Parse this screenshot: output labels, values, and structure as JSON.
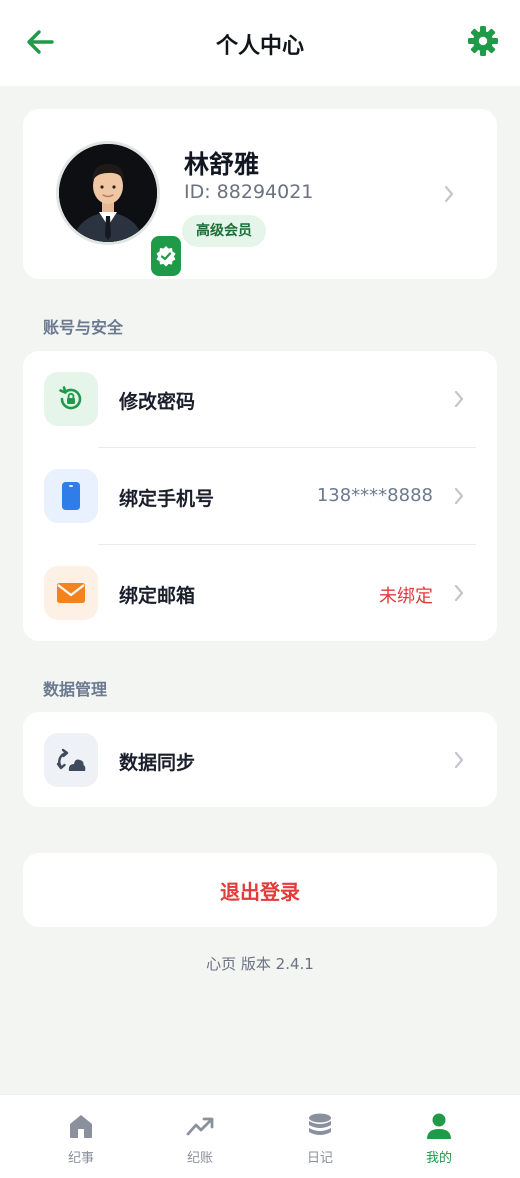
{
  "header": {
    "title": "个人中心",
    "back_icon": "arrow-left-icon",
    "settings_icon": "gear-icon",
    "accent_color": "#1f9a48"
  },
  "profile": {
    "name": "林舒雅",
    "id_text": "ID: 88294021",
    "member_badge": "高级会员",
    "verified_icon": "verified-check-icon"
  },
  "sections": {
    "account": {
      "title": "账号与安全",
      "items": [
        {
          "label": "修改密码",
          "value": "",
          "icon": "password-reset-icon"
        },
        {
          "label": "绑定手机号",
          "value": "138****8888",
          "icon": "phone-icon"
        },
        {
          "label": "绑定邮箱",
          "value": "未绑定",
          "icon": "mail-icon"
        }
      ]
    },
    "data": {
      "title": "数据管理",
      "items": [
        {
          "label": "数据同步",
          "value": "",
          "icon": "cloud-sync-icon"
        }
      ]
    }
  },
  "logout": {
    "label": "退出登录"
  },
  "version": "心页 版本 2.4.1",
  "tabbar": {
    "tabs": [
      {
        "label": "纪事",
        "icon": "home-icon",
        "active": false
      },
      {
        "label": "纪账",
        "icon": "trend-icon",
        "active": false
      },
      {
        "label": "日记",
        "icon": "coin-stack-icon",
        "active": false
      },
      {
        "label": "我的",
        "icon": "user-icon",
        "active": true
      }
    ]
  },
  "colors": {
    "background": "#f3f5f3",
    "danger": "#e33a3a",
    "muted": "#6b7280"
  }
}
